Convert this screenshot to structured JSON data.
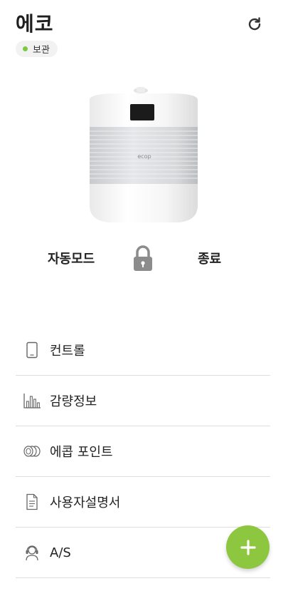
{
  "header": {
    "title": "에코",
    "refresh_icon": "refresh-icon"
  },
  "status": {
    "label": "보관",
    "dot_color": "#7bc943"
  },
  "device": {
    "brand_text": "ecop"
  },
  "modes": {
    "auto_label": "자동모드",
    "off_label": "종료",
    "lock_icon": "lock-icon"
  },
  "menu": {
    "items": [
      {
        "label": "컨트롤",
        "icon": "phone-icon"
      },
      {
        "label": "감량정보",
        "icon": "bar-chart-icon"
      },
      {
        "label": "에콥 포인트",
        "icon": "coins-icon"
      },
      {
        "label": "사용자설명서",
        "icon": "document-icon"
      },
      {
        "label": "A/S",
        "icon": "support-headset-icon"
      }
    ]
  },
  "fab": {
    "icon": "plus-icon",
    "color": "#8dc63f"
  }
}
